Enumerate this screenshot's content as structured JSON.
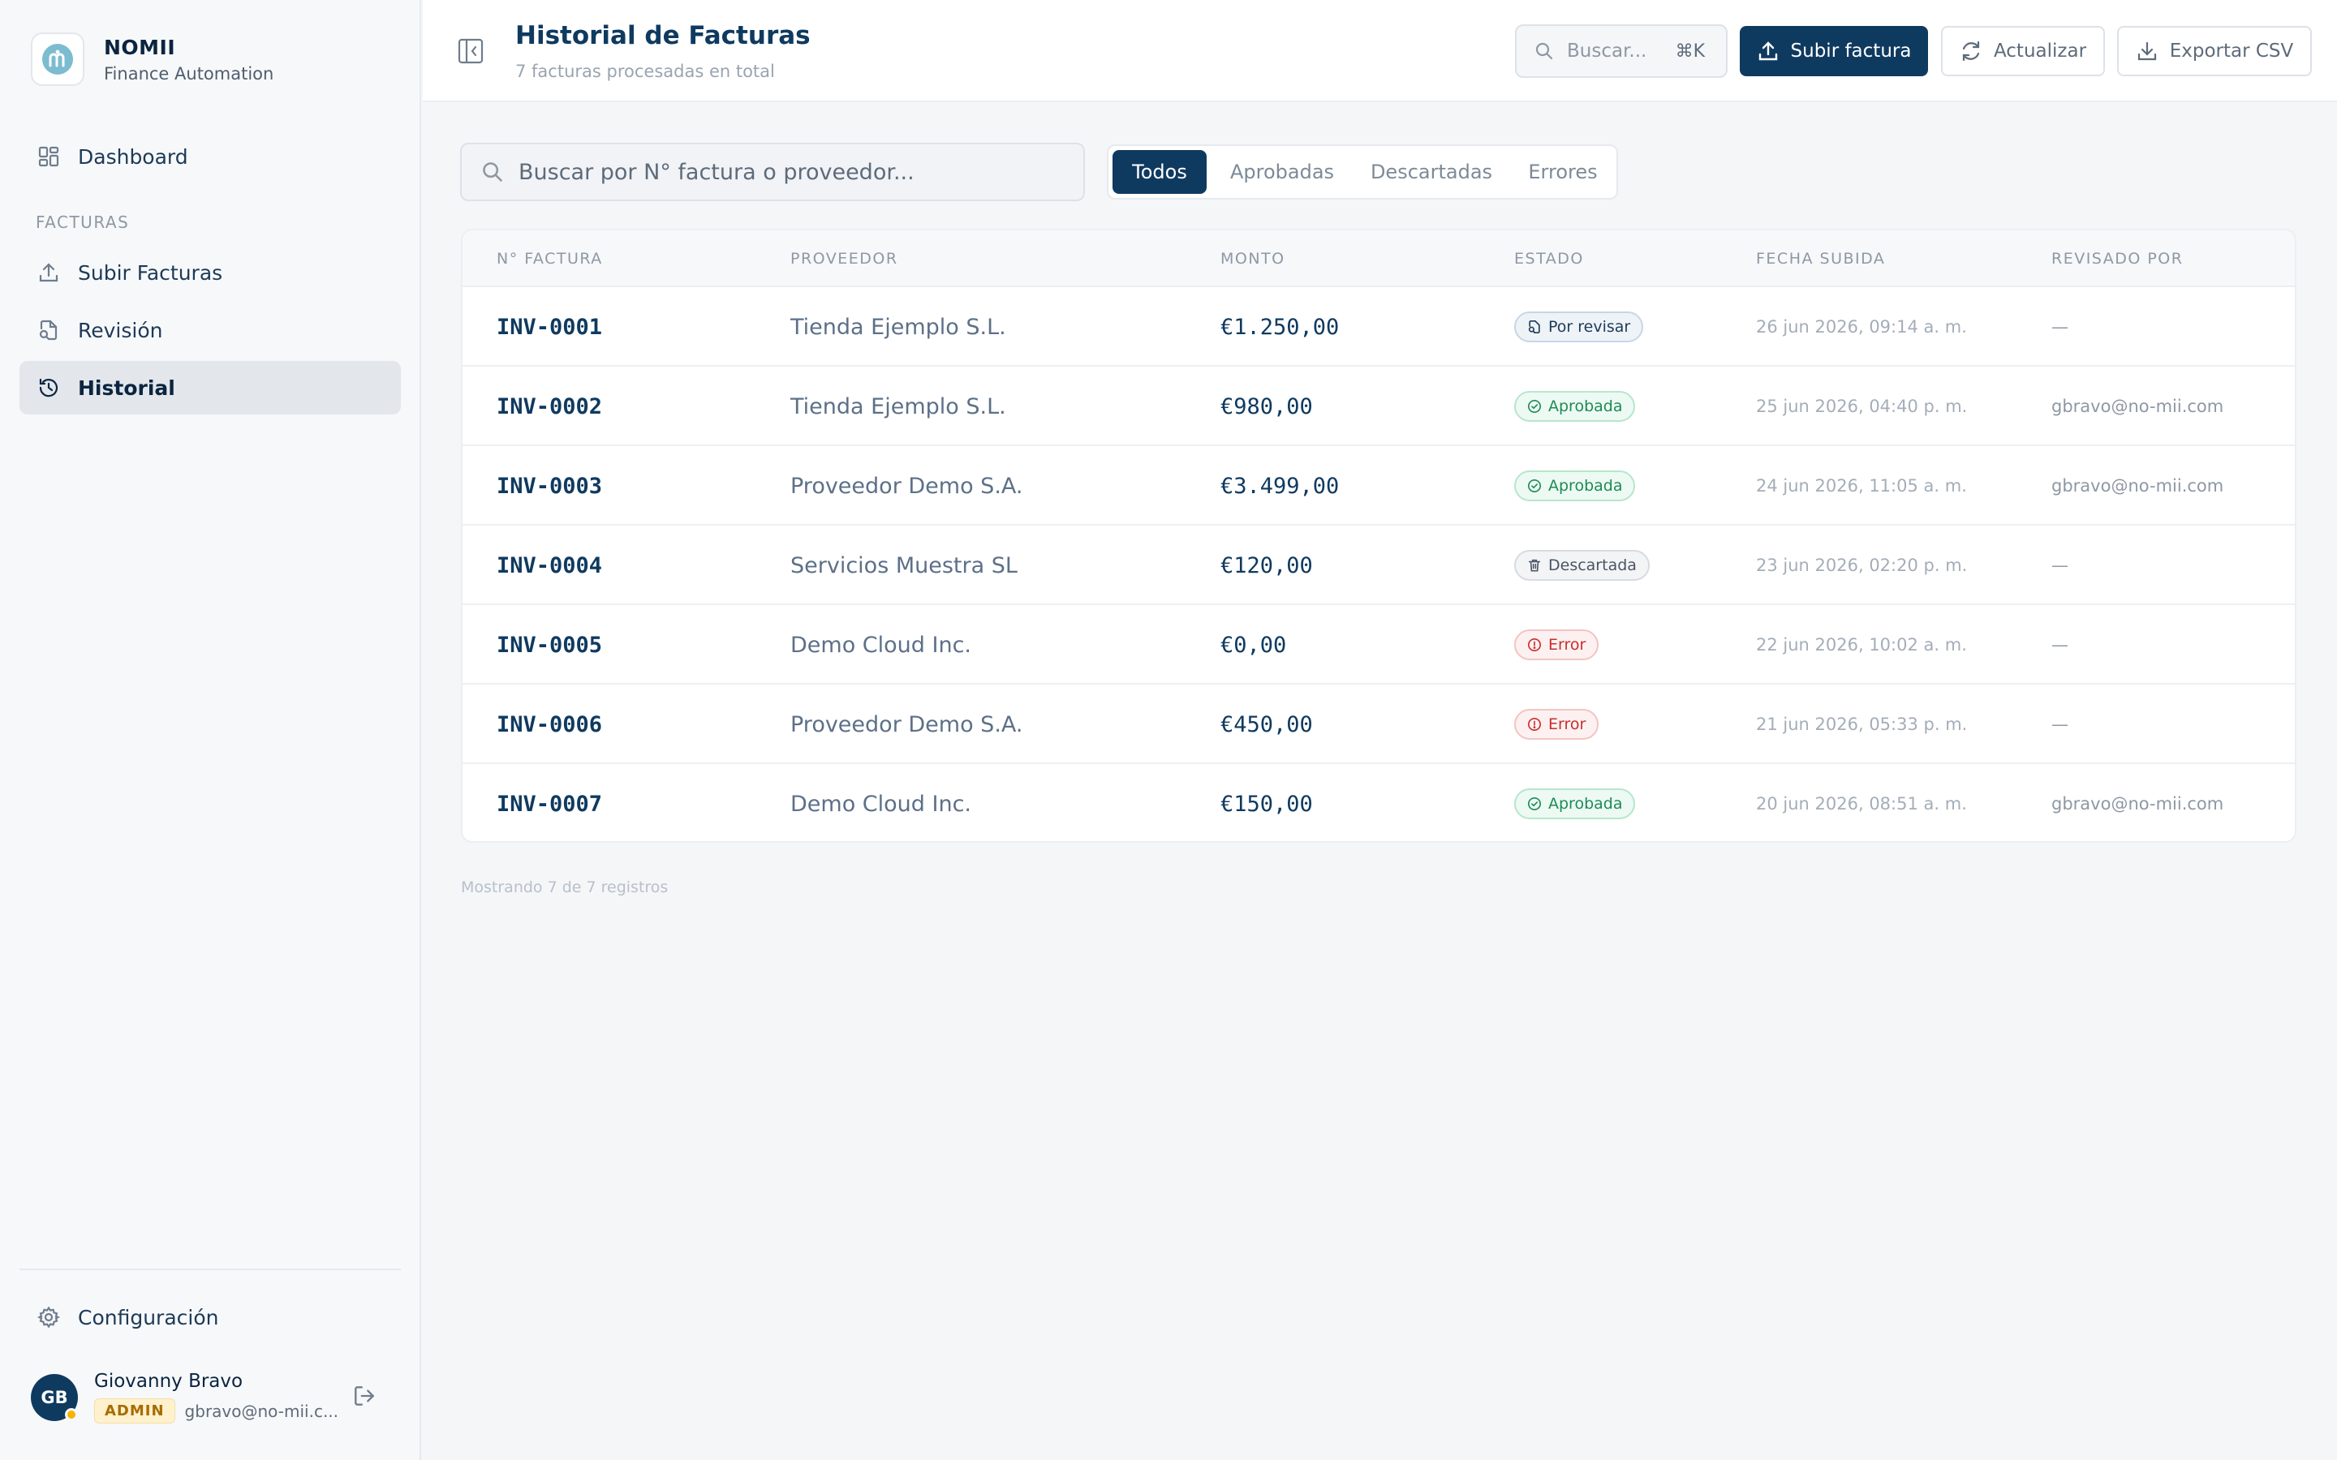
{
  "brand": {
    "name": "NOMII",
    "subtitle": "Finance Automation",
    "icon": "nomii-logo"
  },
  "sidebar": {
    "dashboard": {
      "label": "Dashboard",
      "icon": "dashboard-grid-icon"
    },
    "section_label": "FACTURAS",
    "items": [
      {
        "label": "Subir Facturas",
        "icon": "upload-icon",
        "active": false
      },
      {
        "label": "Revisión",
        "icon": "document-search-icon",
        "active": false
      },
      {
        "label": "Historial",
        "icon": "history-clock-icon",
        "active": true
      }
    ],
    "settings": {
      "label": "Configuración",
      "icon": "gear-icon"
    }
  },
  "user": {
    "initials": "GB",
    "name": "Giovanny Bravo",
    "role": "ADMIN",
    "email": "gbravo@no-mii.c..."
  },
  "header": {
    "title": "Historial de Facturas",
    "subtitle": "7 facturas procesadas en total",
    "search_placeholder": "Buscar...",
    "search_shortcut": "⌘K",
    "upload_label": "Subir factura",
    "refresh_label": "Actualizar",
    "export_label": "Exportar CSV"
  },
  "filters": {
    "search_placeholder": "Buscar por N° factura o proveedor...",
    "tabs": [
      "Todos",
      "Aprobadas",
      "Descartadas",
      "Errores"
    ],
    "active_tab": "Todos"
  },
  "table": {
    "columns": [
      "N° FACTURA",
      "PROVEEDOR",
      "MONTO",
      "ESTADO",
      "FECHA SUBIDA",
      "REVISADO POR"
    ],
    "rows": [
      {
        "invoice": "INV-0001",
        "provider": "Tienda Ejemplo S.L.",
        "amount": "€1.250,00",
        "status": "Por revisar",
        "status_type": "review",
        "date": "26 jun 2026, 09:14 a. m.",
        "reviewer": "—"
      },
      {
        "invoice": "INV-0002",
        "provider": "Tienda Ejemplo S.L.",
        "amount": "€980,00",
        "status": "Aprobada",
        "status_type": "ok",
        "date": "25 jun 2026, 04:40 p. m.",
        "reviewer": "gbravo@no-mii.com"
      },
      {
        "invoice": "INV-0003",
        "provider": "Proveedor Demo S.A.",
        "amount": "€3.499,00",
        "status": "Aprobada",
        "status_type": "ok",
        "date": "24 jun 2026, 11:05 a. m.",
        "reviewer": "gbravo@no-mii.com"
      },
      {
        "invoice": "INV-0004",
        "provider": "Servicios Muestra SL",
        "amount": "€120,00",
        "status": "Descartada",
        "status_type": "disc",
        "date": "23 jun 2026, 02:20 p. m.",
        "reviewer": "—"
      },
      {
        "invoice": "INV-0005",
        "provider": "Demo Cloud Inc.",
        "amount": "€0,00",
        "status": "Error",
        "status_type": "err",
        "date": "22 jun 2026, 10:02 a. m.",
        "reviewer": "—"
      },
      {
        "invoice": "INV-0006",
        "provider": "Proveedor Demo S.A.",
        "amount": "€450,00",
        "status": "Error",
        "status_type": "err",
        "date": "21 jun 2026, 05:33 p. m.",
        "reviewer": "—"
      },
      {
        "invoice": "INV-0007",
        "provider": "Demo Cloud Inc.",
        "amount": "€150,00",
        "status": "Aprobada",
        "status_type": "ok",
        "date": "20 jun 2026, 08:51 a. m.",
        "reviewer": "gbravo@no-mii.com"
      }
    ]
  },
  "footer": {
    "count_text": "Mostrando 7 de 7 registros"
  },
  "colors": {
    "primary": "#0f3a60",
    "success": "#1f8a55",
    "danger": "#c62f2f",
    "warning": "#f5b400"
  }
}
